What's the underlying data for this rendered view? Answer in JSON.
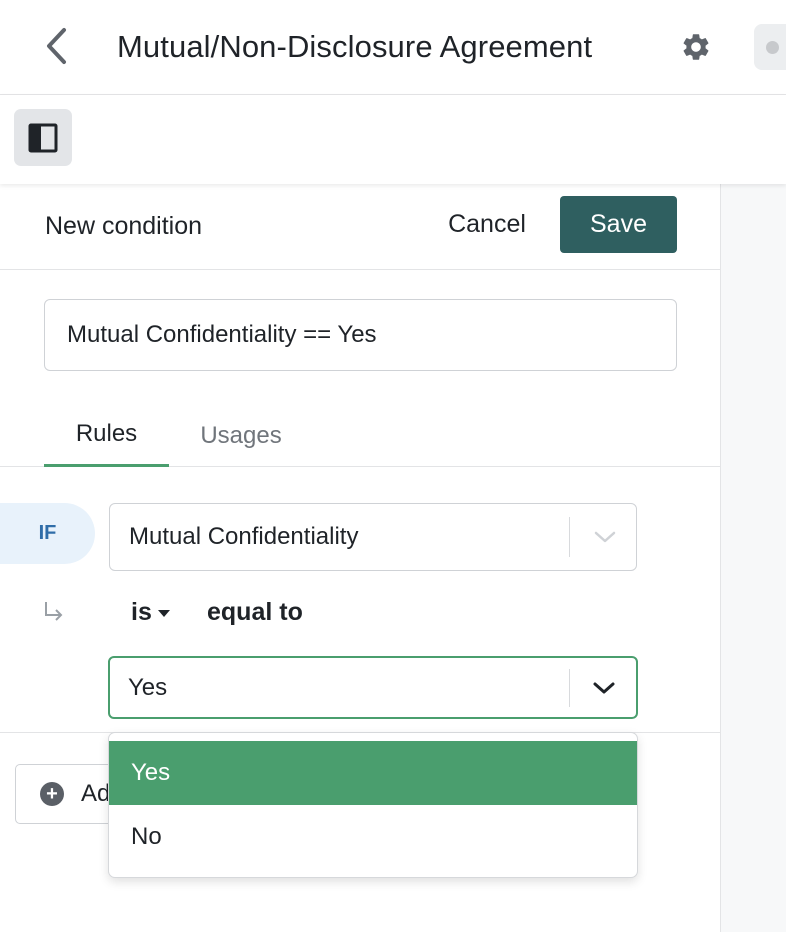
{
  "header": {
    "title": "Mutual/Non-Disclosure Agreement",
    "back_icon": "chevron-left-icon",
    "settings_icon": "gear-icon"
  },
  "toolbar": {
    "panel_toggle_icon": "sidebar-panel-icon",
    "document_icon": "document-icon"
  },
  "condition_panel": {
    "heading": "New condition",
    "cancel_label": "Cancel",
    "save_label": "Save",
    "name_value": "Mutual Confidentiality == Yes",
    "tabs": [
      {
        "label": "Rules",
        "active": true
      },
      {
        "label": "Usages",
        "active": false
      }
    ],
    "rule": {
      "if_label": "IF",
      "field": "Mutual Confidentiality",
      "operator": "is",
      "comparison": "equal to",
      "value": "Yes"
    },
    "add_label": "Ad",
    "value_options": [
      {
        "label": "Yes",
        "selected": true
      },
      {
        "label": "No",
        "selected": false
      }
    ]
  },
  "colors": {
    "accent_green": "#4a9e6e",
    "save_button": "#2f5f60",
    "if_badge_bg": "#e8f2fb",
    "if_badge_text": "#2f6da8"
  }
}
